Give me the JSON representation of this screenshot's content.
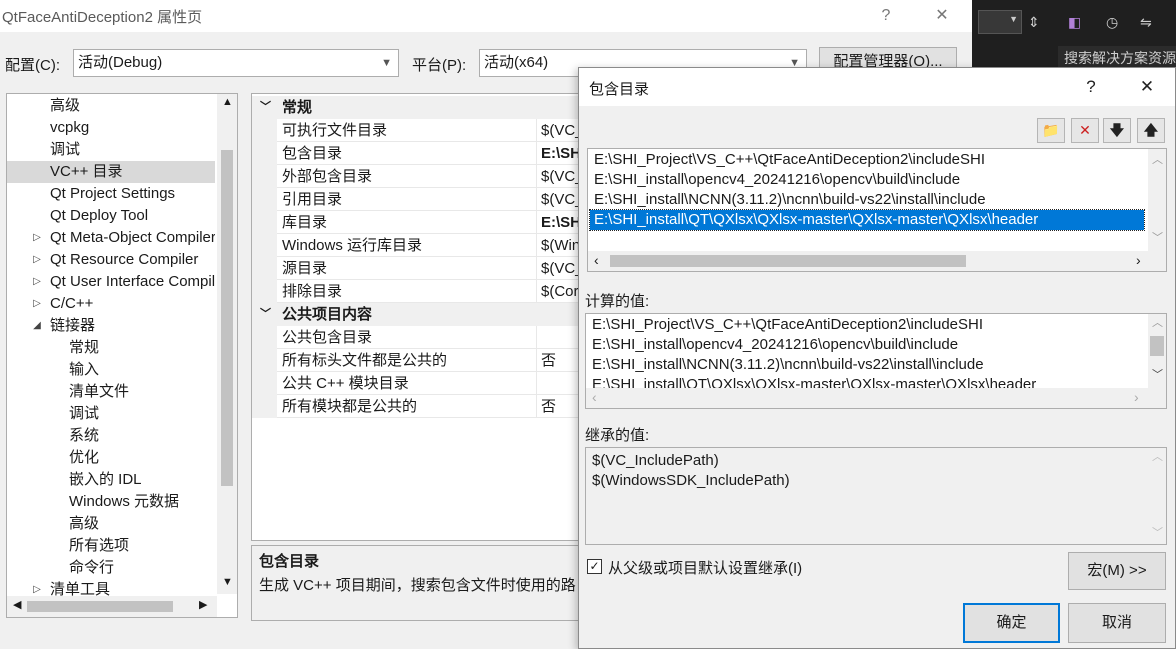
{
  "main_window": {
    "title": "QtFaceAntiDeception2 属性页",
    "help_glyph": "?",
    "close_glyph": "✕",
    "config_label": "配置(C):",
    "config_value": "活动(Debug)",
    "platform_label": "平台(P):",
    "platform_value": "活动(x64)",
    "config_manager_label": "配置管理器(O)..."
  },
  "tree": {
    "items": [
      {
        "label": "高级",
        "level": 1,
        "expander": ""
      },
      {
        "label": "vcpkg",
        "level": 1,
        "expander": ""
      },
      {
        "label": "调试",
        "level": 1,
        "expander": ""
      },
      {
        "label": "VC++ 目录",
        "level": 1,
        "expander": "",
        "selected": true
      },
      {
        "label": "Qt Project Settings",
        "level": 1,
        "expander": ""
      },
      {
        "label": "Qt Deploy Tool",
        "level": 1,
        "expander": ""
      },
      {
        "label": "Qt Meta-Object Compiler",
        "level": 1,
        "expander": "▷"
      },
      {
        "label": "Qt Resource Compiler",
        "level": 1,
        "expander": "▷"
      },
      {
        "label": "Qt User Interface Compiler",
        "level": 1,
        "expander": "▷"
      },
      {
        "label": "C/C++",
        "level": 1,
        "expander": "▷"
      },
      {
        "label": "链接器",
        "level": 1,
        "expander": "◢"
      },
      {
        "label": "常规",
        "level": 2,
        "expander": ""
      },
      {
        "label": "输入",
        "level": 2,
        "expander": ""
      },
      {
        "label": "清单文件",
        "level": 2,
        "expander": ""
      },
      {
        "label": "调试",
        "level": 2,
        "expander": ""
      },
      {
        "label": "系统",
        "level": 2,
        "expander": ""
      },
      {
        "label": "优化",
        "level": 2,
        "expander": ""
      },
      {
        "label": "嵌入的 IDL",
        "level": 2,
        "expander": ""
      },
      {
        "label": "Windows 元数据",
        "level": 2,
        "expander": ""
      },
      {
        "label": "高级",
        "level": 2,
        "expander": ""
      },
      {
        "label": "所有选项",
        "level": 2,
        "expander": ""
      },
      {
        "label": "命令行",
        "level": 2,
        "expander": ""
      },
      {
        "label": "清单工具",
        "level": 1,
        "expander": "▷"
      }
    ]
  },
  "grid": {
    "categories": [
      {
        "label": "常规",
        "rows": [
          {
            "name": "可执行文件目录",
            "value": "$(VC_",
            "bold": false
          },
          {
            "name": "包含目录",
            "value": "E:\\SH",
            "bold": true
          },
          {
            "name": "外部包含目录",
            "value": "$(VC_",
            "bold": false
          },
          {
            "name": "引用目录",
            "value": "$(VC_",
            "bold": false
          },
          {
            "name": "库目录",
            "value": "E:\\SH",
            "bold": true
          },
          {
            "name": "Windows 运行库目录",
            "value": "$(Win",
            "bold": false
          },
          {
            "name": "源目录",
            "value": "$(VC_",
            "bold": false
          },
          {
            "name": "排除目录",
            "value": "$(Cor",
            "bold": false
          }
        ]
      },
      {
        "label": "公共项目内容",
        "rows": [
          {
            "name": "公共包含目录",
            "value": "",
            "bold": false
          },
          {
            "name": "所有标头文件都是公共的",
            "value": "否",
            "bold": false
          },
          {
            "name": "公共 C++ 模块目录",
            "value": "",
            "bold": false
          },
          {
            "name": "所有模块都是公共的",
            "value": "否",
            "bold": false
          }
        ]
      }
    ]
  },
  "description": {
    "title": "包含目录",
    "text": "生成 VC++ 项目期间，搜索包含文件时使用的路"
  },
  "ide": {
    "search_placeholder": "搜索解决方案资源"
  },
  "dialog": {
    "title": "包含目录",
    "help_glyph": "?",
    "close_glyph": "✕",
    "tools": [
      {
        "name": "new-folder-icon",
        "glyph": "📁",
        "color": "#c8a040"
      },
      {
        "name": "delete-icon",
        "glyph": "✕",
        "color": "#cc1f1f"
      },
      {
        "name": "move-down-icon",
        "glyph": "🡇",
        "color": "#222222"
      },
      {
        "name": "move-up-icon",
        "glyph": "🡅",
        "color": "#222222"
      }
    ],
    "paths": [
      "E:\\SHI_Project\\VS_C++\\QtFaceAntiDeception2\\includeSHI",
      "E:\\SHI_install\\opencv4_20241216\\opencv\\build\\include",
      "E:\\SHI_install\\NCNN(3.11.2)\\ncnn\\build-vs22\\install\\include",
      "E:\\SHI_install\\QT\\QXlsx\\QXlsx-master\\QXlsx-master\\QXlsx\\header"
    ],
    "selected_index": 3,
    "computed_label": "计算的值:",
    "computed": [
      "E:\\SHI_Project\\VS_C++\\QtFaceAntiDeception2\\includeSHI",
      "E:\\SHI_install\\opencv4_20241216\\opencv\\build\\include",
      "E:\\SHI_install\\NCNN(3.11.2)\\ncnn\\build-vs22\\install\\include",
      "E:\\SHI_install\\QT\\QXlsx\\QXlsx-master\\QXlsx-master\\QXlsx\\header"
    ],
    "inherited_label": "继承的值:",
    "inherited": [
      "$(VC_IncludePath)",
      "$(WindowsSDK_IncludePath)"
    ],
    "inherit_checkbox_label": "从父级或项目默认设置继承(I)",
    "inherit_checked": true,
    "macros_label": "宏(M) >>",
    "ok_label": "确定",
    "cancel_label": "取消",
    "accent": "#0078d7"
  }
}
